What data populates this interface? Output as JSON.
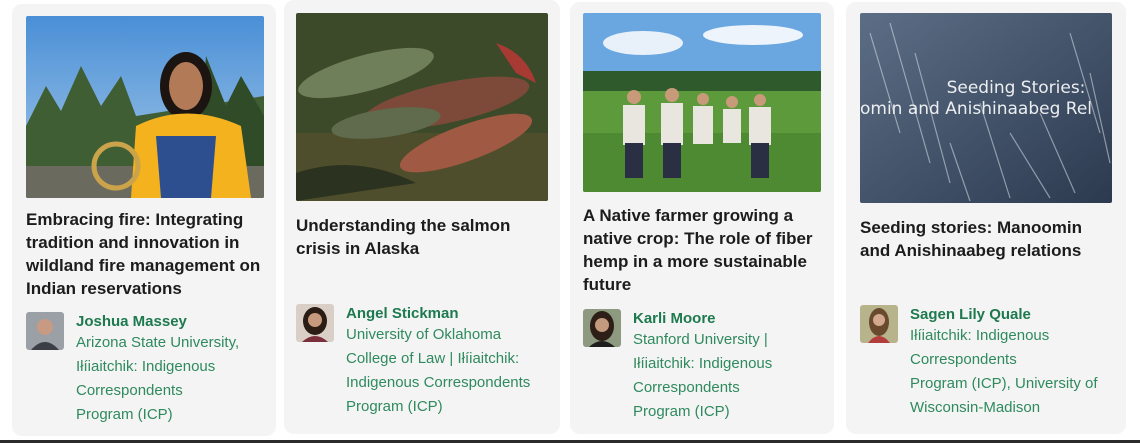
{
  "cards": [
    {
      "title": "Embracing fire: Integrating tradition and innovation in wildland fire management on Indian reservations",
      "author": "Joshua Massey",
      "affiliation": [
        "Arizona State University,",
        "Iłíiaitchik: Indigenous",
        "Correspondents",
        "Program (ICP)"
      ]
    },
    {
      "title": "Understanding the salmon crisis in Alaska",
      "author": "Angel Stickman",
      "affiliation": [
        "University of Oklahoma",
        "College of Law | Iłíiaitchik:",
        "Indigenous Correspondents",
        "Program (ICP)"
      ]
    },
    {
      "title": "A Native farmer growing a native crop: The role of fiber hemp in a more sustainable future",
      "author": "Karli Moore",
      "affiliation": [
        "Stanford University |",
        "Iłíiaitchik: Indigenous",
        "Correspondents",
        "Program (ICP)"
      ]
    },
    {
      "title": "Seeding stories: Manoomin and Anishinaabeg relations",
      "author": "Sagen Lily Quale",
      "affiliation": [
        "Iłíiaitchik: Indigenous",
        "Correspondents",
        "Program (ICP), University of",
        "Wisconsin-Madison"
      ],
      "image_caption_lines": [
        "Seeding Stories:",
        "omin and Anishinaabeg Rel"
      ]
    }
  ],
  "colors": {
    "card_bg": "#f4f4f5",
    "title": "#1c1c1c",
    "author_name": "#1d7a4e",
    "affiliation": "#2f8a5d"
  }
}
